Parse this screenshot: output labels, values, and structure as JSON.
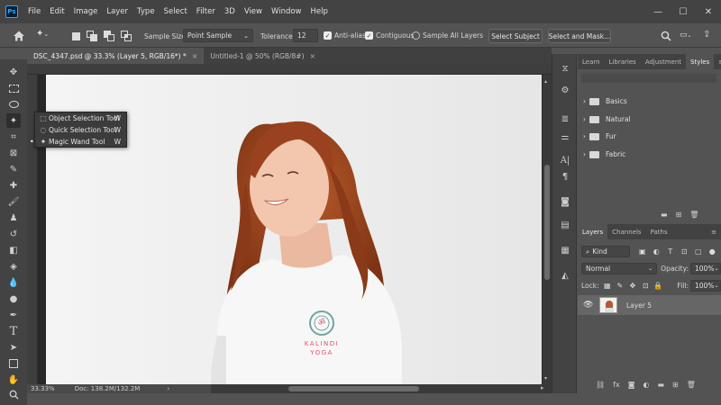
{
  "app": {
    "logo_text": "Ps"
  },
  "menu": [
    "File",
    "Edit",
    "Image",
    "Layer",
    "Type",
    "Select",
    "Filter",
    "3D",
    "View",
    "Window",
    "Help"
  ],
  "window_controls": {
    "minimize": "—",
    "maximize": "☐",
    "close": "✕"
  },
  "options_bar": {
    "sample_size_label": "Sample Size:",
    "sample_size_value": "Point Sample",
    "tolerance_label": "Tolerance:",
    "tolerance_value": "12",
    "anti_alias_label": "Anti-alias",
    "contiguous_label": "Contiguous",
    "sample_all_layers_label": "Sample All Layers",
    "select_subject_label": "Select Subject",
    "select_and_mask_label": "Select and Mask..."
  },
  "tabs": [
    {
      "label": "DSC_4347.psd @ 33.3% (Layer 5, RGB/16*) *",
      "close": "×"
    },
    {
      "label": "Untitled-1 @ 50% (RGB/8#)",
      "close": "×"
    }
  ],
  "tool_flyout": [
    {
      "label": "Object Selection Tool",
      "key": "W"
    },
    {
      "label": "Quick Selection Tool",
      "key": "W"
    },
    {
      "label": "Magic Wand Tool",
      "key": "W"
    }
  ],
  "photo": {
    "shirt_text_line1": "KALINDI",
    "shirt_text_line2": "YOGA",
    "logo_glyph": "ॐ"
  },
  "status": {
    "zoom": "33.33%",
    "doc": "Doc: 138.2M/132.2M"
  },
  "libraries_panel": {
    "tabs": [
      "Learn",
      "Libraries",
      "Adjustment",
      "Styles"
    ],
    "active_tab": "Styles",
    "items": [
      "Basics",
      "Natural",
      "Fur",
      "Fabric"
    ]
  },
  "layers_panel": {
    "tabs": [
      "Layers",
      "Channels",
      "Paths"
    ],
    "filter_kind": "Kind",
    "blend_mode": "Normal",
    "opacity_label": "Opacity:",
    "opacity_value": "100%",
    "lock_label": "Lock:",
    "fill_label": "Fill:",
    "fill_value": "100%",
    "layers": [
      {
        "name": "Layer 5"
      }
    ]
  },
  "colors": {
    "accent": "#31a8ff",
    "shirt_text": "#e0506e"
  }
}
